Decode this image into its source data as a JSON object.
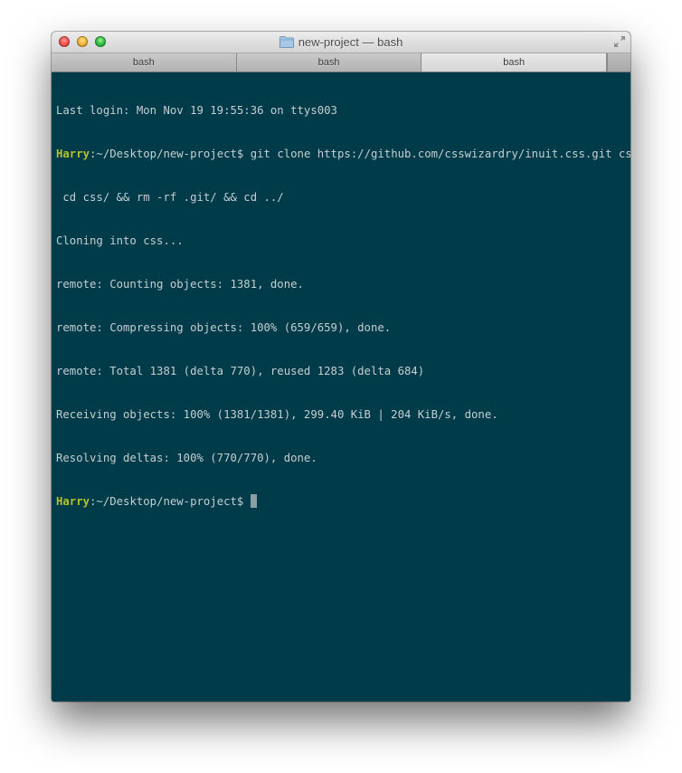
{
  "window": {
    "title": "new-project — bash"
  },
  "tabs": [
    {
      "label": "bash",
      "active": false
    },
    {
      "label": "bash",
      "active": false
    },
    {
      "label": "bash",
      "active": true
    }
  ],
  "terminal": {
    "last_login": "Last login: Mon Nov 19 19:55:36 on ttys003",
    "prompt1_user": "Harry",
    "prompt1_path": ":~/Desktop/new-project$ ",
    "command_line1": "git clone https://github.com/csswizardry/inuit.css.git css &&",
    "command_line2": " cd css/ && rm -rf .git/ && cd ../",
    "output": [
      "Cloning into css...",
      "remote: Counting objects: 1381, done.",
      "remote: Compressing objects: 100% (659/659), done.",
      "remote: Total 1381 (delta 770), reused 1283 (delta 684)",
      "Receiving objects: 100% (1381/1381), 299.40 KiB | 204 KiB/s, done.",
      "Resolving deltas: 100% (770/770), done."
    ],
    "prompt2_user": "Harry",
    "prompt2_path": ":~/Desktop/new-project$ "
  },
  "colors": {
    "background": "#003b4a",
    "text": "#c5ced0",
    "prompt_user": "#b5c22b"
  },
  "icons": {
    "title_icon": "folder-icon",
    "fullscreen": "fullscreen-icon"
  }
}
